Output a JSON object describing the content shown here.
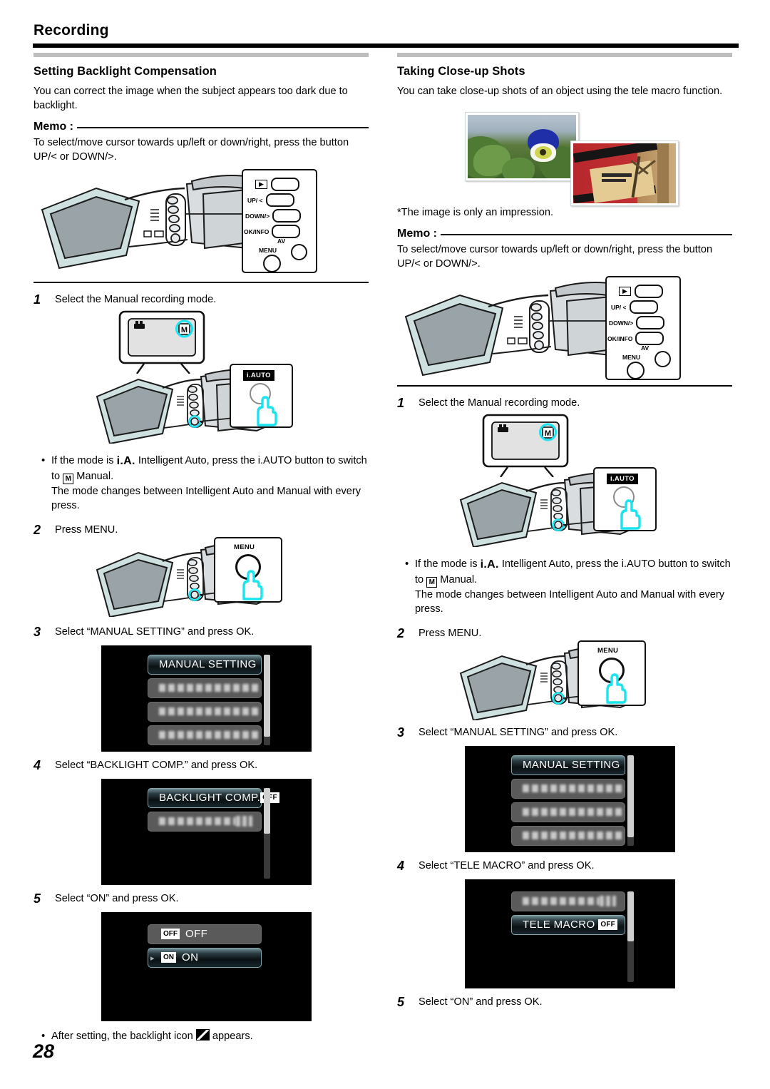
{
  "header": {
    "title": "Recording"
  },
  "left": {
    "section_title": "Setting Backlight Compensation",
    "intro": "You can correct the image when the subject appears too dark due to backlight.",
    "memo_label": "Memo :",
    "memo_text": "To select/move cursor towards up/left or down/right, press the button UP/< or DOWN/>.",
    "buttons": {
      "play": "▶",
      "up": "UP/ <",
      "down": "DOWN/>",
      "ok": "OK/INFO",
      "av": "AV",
      "menu": "MENU"
    },
    "steps": [
      {
        "num": "1",
        "text": "Select the Manual recording mode."
      },
      {
        "num": "2",
        "text": "Press MENU."
      },
      {
        "num": "3",
        "text": "Select “MANUAL SETTING” and press OK."
      },
      {
        "num": "4",
        "text": "Select “BACKLIGHT COMP.” and press OK."
      },
      {
        "num": "5",
        "text": "Select “ON” and press OK."
      }
    ],
    "bullet": {
      "dot": "•",
      "pre": "If the mode is",
      "iauto_glyph": "i.A.",
      "mid": "Intelligent Auto, press the i.AUTO button to switch to",
      "m_glyph": "M",
      "post": "Manual.",
      "line2": "The mode changes between Intelligent Auto and Manual with every press."
    },
    "iauto_label": "i.AUTO",
    "menu_label": "MENU",
    "screens": {
      "manual_setting": {
        "selected": "MANUAL SETTING",
        "blurred_rows": 3
      },
      "backlight": {
        "selected": "BACKLIGHT COMP.",
        "badge": "OFF",
        "blurred_rows": 1
      },
      "onoff": {
        "off": "OFF",
        "off_badge": "OFF",
        "on": "ON",
        "on_badge": "ON"
      }
    },
    "footnote": {
      "dot": "•",
      "pre": "After setting, the backlight icon",
      "post": "appears."
    }
  },
  "right": {
    "section_title": "Taking Close-up Shots",
    "intro": "You can take close-up shots of an object using the tele macro function.",
    "photo_note": "*The image is only an impression.",
    "memo_label": "Memo :",
    "memo_text": "To select/move cursor towards up/left or down/right, press the button UP/< or DOWN/>.",
    "buttons": {
      "play": "▶",
      "up": "UP/ <",
      "down": "DOWN/>",
      "ok": "OK/INFO",
      "av": "AV",
      "menu": "MENU"
    },
    "steps": [
      {
        "num": "1",
        "text": "Select the Manual recording mode."
      },
      {
        "num": "2",
        "text": "Press MENU."
      },
      {
        "num": "3",
        "text": "Select “MANUAL SETTING” and press OK."
      },
      {
        "num": "4",
        "text": "Select “TELE MACRO” and press OK."
      },
      {
        "num": "5",
        "text": "Select “ON” and press OK."
      }
    ],
    "bullet": {
      "dot": "•",
      "pre": "If the mode is",
      "iauto_glyph": "i.A.",
      "mid": "Intelligent Auto, press the i.AUTO button to switch to",
      "m_glyph": "M",
      "post": "Manual.",
      "line2": "The mode changes between Intelligent Auto and Manual with every press."
    },
    "iauto_label": "i.AUTO",
    "menu_label": "MENU",
    "screens": {
      "manual_setting": {
        "selected": "MANUAL SETTING",
        "blurred_rows": 3
      },
      "tele_macro": {
        "selected": "TELE MACRO",
        "badge": "OFF",
        "blurred_rows": 1
      }
    }
  },
  "footer": {
    "page_number": "28"
  },
  "colors": {
    "accent_cyan": "#19e4f0",
    "rule_black": "#000000",
    "grey_bar": "#bdbdbd",
    "lcd_black": "#000000",
    "lcd_row_dim": "#5a5a5a"
  }
}
